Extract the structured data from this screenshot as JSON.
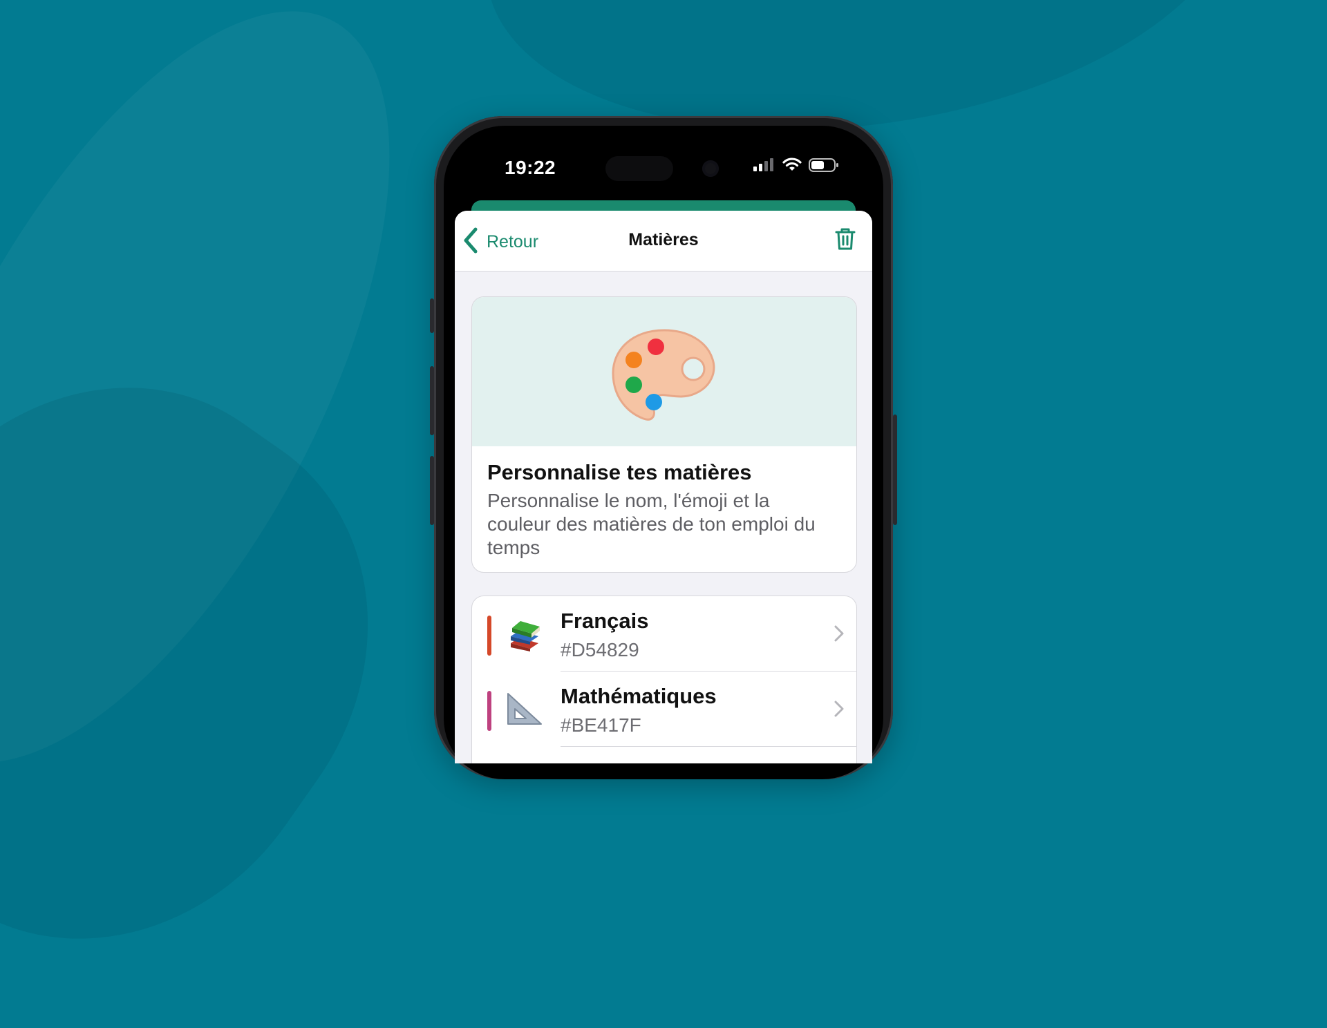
{
  "status_bar": {
    "time": "19:22"
  },
  "nav": {
    "back_label": "Retour",
    "title": "Matières"
  },
  "card": {
    "title": "Personnalise tes matières",
    "description": "Personnalise le nom, l'émoji et la couleur des matières de ton emploi du temps",
    "hero_icon": "palette-icon"
  },
  "subjects": [
    {
      "name": "Français",
      "color_code": "#D54829",
      "color": "#D54829",
      "emoji": "books-icon"
    },
    {
      "name": "Mathématiques",
      "color_code": "#BE417F",
      "color": "#BE417F",
      "emoji": "triangular-ruler-icon"
    }
  ],
  "colors": {
    "accent": "#1a8a6e",
    "background": "#027b91"
  }
}
